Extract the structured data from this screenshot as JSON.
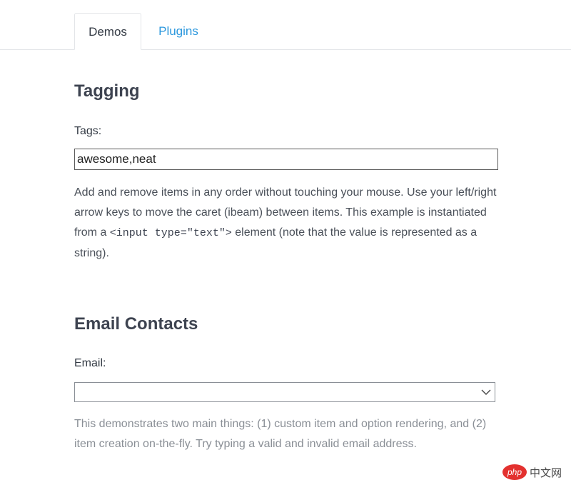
{
  "tabs": {
    "demos": "Demos",
    "plugins": "Plugins"
  },
  "tagging": {
    "heading": "Tagging",
    "label": "Tags:",
    "value": "awesome,neat",
    "desc_1": "Add and remove items in any order without touching your mouse. Use your left/right arrow keys to move the caret (ibeam) between items. This example is instantiated from a ",
    "desc_code": "<input type=\"text\">",
    "desc_2": " element (note that the value is represented as a string)."
  },
  "email": {
    "heading": "Email Contacts",
    "label": "Email:",
    "value": "",
    "desc": "This demonstrates two main things: (1) custom item and option rendering, and (2) item creation on-the-fly. Try typing a valid and invalid email address."
  },
  "watermark": {
    "logo_text": "php",
    "site_text": "中文网"
  },
  "colors": {
    "link": "#2a97dd",
    "watermark_red": "#e3312f"
  }
}
